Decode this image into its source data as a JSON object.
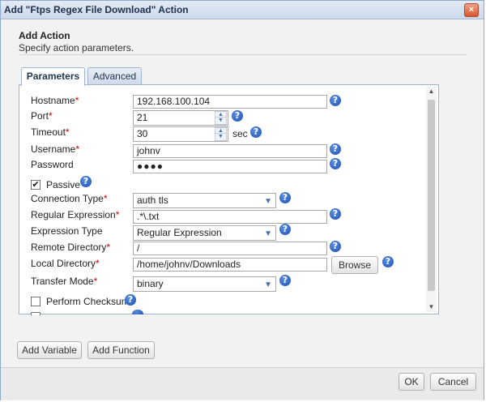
{
  "window": {
    "title": "Add \"Ftps Regex File Download\" Action",
    "close_label": "×"
  },
  "header": {
    "title": "Add Action",
    "subtitle": "Specify action parameters."
  },
  "tabs": [
    {
      "label": "Parameters"
    },
    {
      "label": "Advanced"
    }
  ],
  "help_glyph": "?",
  "fields": {
    "hostname": {
      "label": "Hostname",
      "value": "192.168.100.104",
      "required": "*"
    },
    "port": {
      "label": "Port",
      "value": "21",
      "required": "*"
    },
    "timeout": {
      "label": "Timeout",
      "value": "30",
      "unit": "sec",
      "required": "*"
    },
    "username": {
      "label": "Username",
      "value": "johnv",
      "required": "*"
    },
    "password": {
      "label": "Password",
      "value": "●●●●"
    },
    "passive": {
      "label": "Passive",
      "checked": "✔"
    },
    "connection_type": {
      "label": "Connection Type",
      "value": "auth tls",
      "required": "*"
    },
    "regular_expression": {
      "label": "Regular Expression",
      "value": ".*\\.txt",
      "required": "*"
    },
    "expression_type": {
      "label": "Expression Type",
      "value": "Regular Expression"
    },
    "remote_directory": {
      "label": "Remote Directory",
      "value": "/",
      "required": "*"
    },
    "local_directory": {
      "label": "Local Directory",
      "value": "/home/johnv/Downloads",
      "required": "*",
      "browse_label": "Browse"
    },
    "transfer_mode": {
      "label": "Transfer Mode",
      "value": "binary",
      "required": "*"
    },
    "perform_checksum": {
      "label": "Perform Checksum"
    }
  },
  "footer": {
    "add_variable": "Add Variable",
    "add_function": "Add Function",
    "ok": "OK",
    "cancel": "Cancel"
  }
}
